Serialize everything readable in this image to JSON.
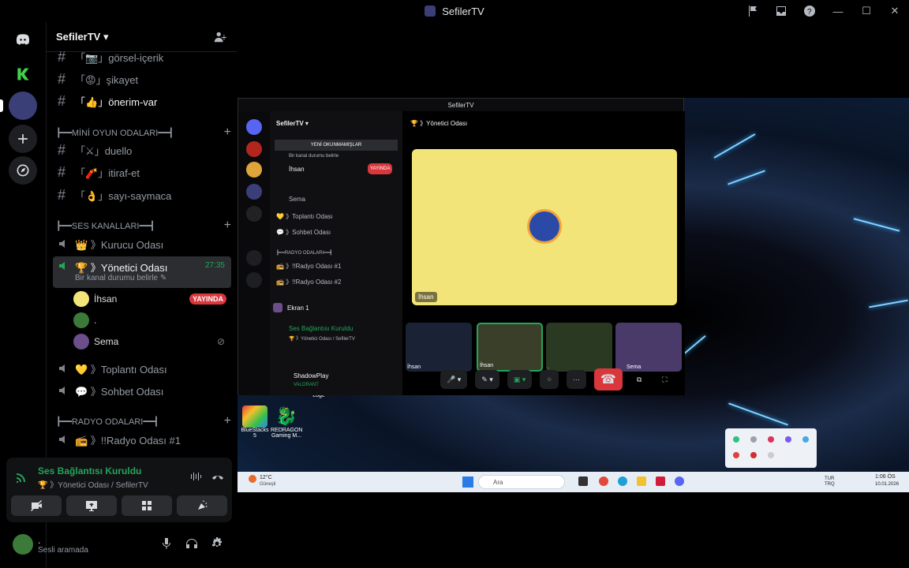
{
  "window": {
    "title": "SefilerTV"
  },
  "server": {
    "name": "SefilerTV"
  },
  "channels": {
    "text_top": [
      {
        "icon": "📷",
        "label": "görsel-içerik"
      },
      {
        "icon": "😡",
        "label": "şikayet"
      },
      {
        "icon": "👍",
        "label": "önerim-var"
      }
    ],
    "category_games": "┣━━MİNİ OYUN ODALARI━━┫",
    "games": [
      {
        "icon": "⚔",
        "label": "duello"
      },
      {
        "icon": "🧨",
        "label": "itiraf-et"
      },
      {
        "icon": "👌",
        "label": "sayı-saymaca"
      }
    ],
    "category_voice": "┣━━SES KANALLARI━━┫",
    "voice": [
      {
        "icon": "👑",
        "label": "Kurucu Odası"
      },
      {
        "icon": "🏆",
        "label": "Yönetici Odası",
        "timer": "27:35",
        "status": "Bir kanal durumu belirle ✎"
      },
      {
        "icon": "💛",
        "label": "Toplantı Odası"
      },
      {
        "icon": "💬",
        "label": "Sohbet Odası"
      }
    ],
    "members": [
      {
        "name": "İhsan",
        "badge": "YAYINDA"
      },
      {
        "name": "."
      },
      {
        "name": "Sema"
      }
    ],
    "category_radio": "┣━━RADYO ODALARI━━┫",
    "radio": [
      {
        "icon": "📻",
        "label": "!!Radyo Odası #1"
      }
    ]
  },
  "voice_panel": {
    "connected": "Ses Bağlantısı Kuruldu",
    "location": "🏆 》Yönetici Odası / SefilerTV"
  },
  "user": {
    "name": ".",
    "status": "Sesli aramada"
  },
  "inner": {
    "title": "SefilerTV",
    "server": "SefilerTV",
    "channel": "🏆 》Yönetici Odası",
    "unread": "YENİ OKUNMAMIŞLAR",
    "status": "Bir kanal durumu belirle",
    "members": [
      "İhsan",
      "Sema"
    ],
    "badge": "YAYINDA",
    "voice": [
      "💛 》Toplantı Odası",
      "💬 》Sohbet Odası"
    ],
    "radio_cat": "┣━━RADYO ODALARI━━┫",
    "radio": [
      "📻 》!!Radyo Odası #1",
      "📻 》!!Radyo Odası #2"
    ],
    "screen": "Ekran 1",
    "conn": "Ses Bağlantısı Kuruldu",
    "conn_sub": "🏆 》Yönetici Odası / SefilerTV",
    "user": "ShadowPlay",
    "user_sub": "VALORANT",
    "tile_label": "İhsan",
    "thumb_labels": [
      "İhsan",
      "İhsan",
      ".",
      "Sema"
    ]
  },
  "desktop": {
    "icons": [
      {
        "label": "BlueStacks 5"
      },
      {
        "label": "REDRAGON Gaming M..."
      }
    ],
    "extra_label": "Loge",
    "weather": "12°C",
    "weather_sub": "Güneşli",
    "search": "Ara",
    "lang": "TUR\nTRQ",
    "time": "1:06 ÖS",
    "date": "10.01.2026"
  },
  "colors": {
    "accent_green": "#23a55a",
    "live_red": "#da373c",
    "tile_yellow": "#f3e47a"
  }
}
